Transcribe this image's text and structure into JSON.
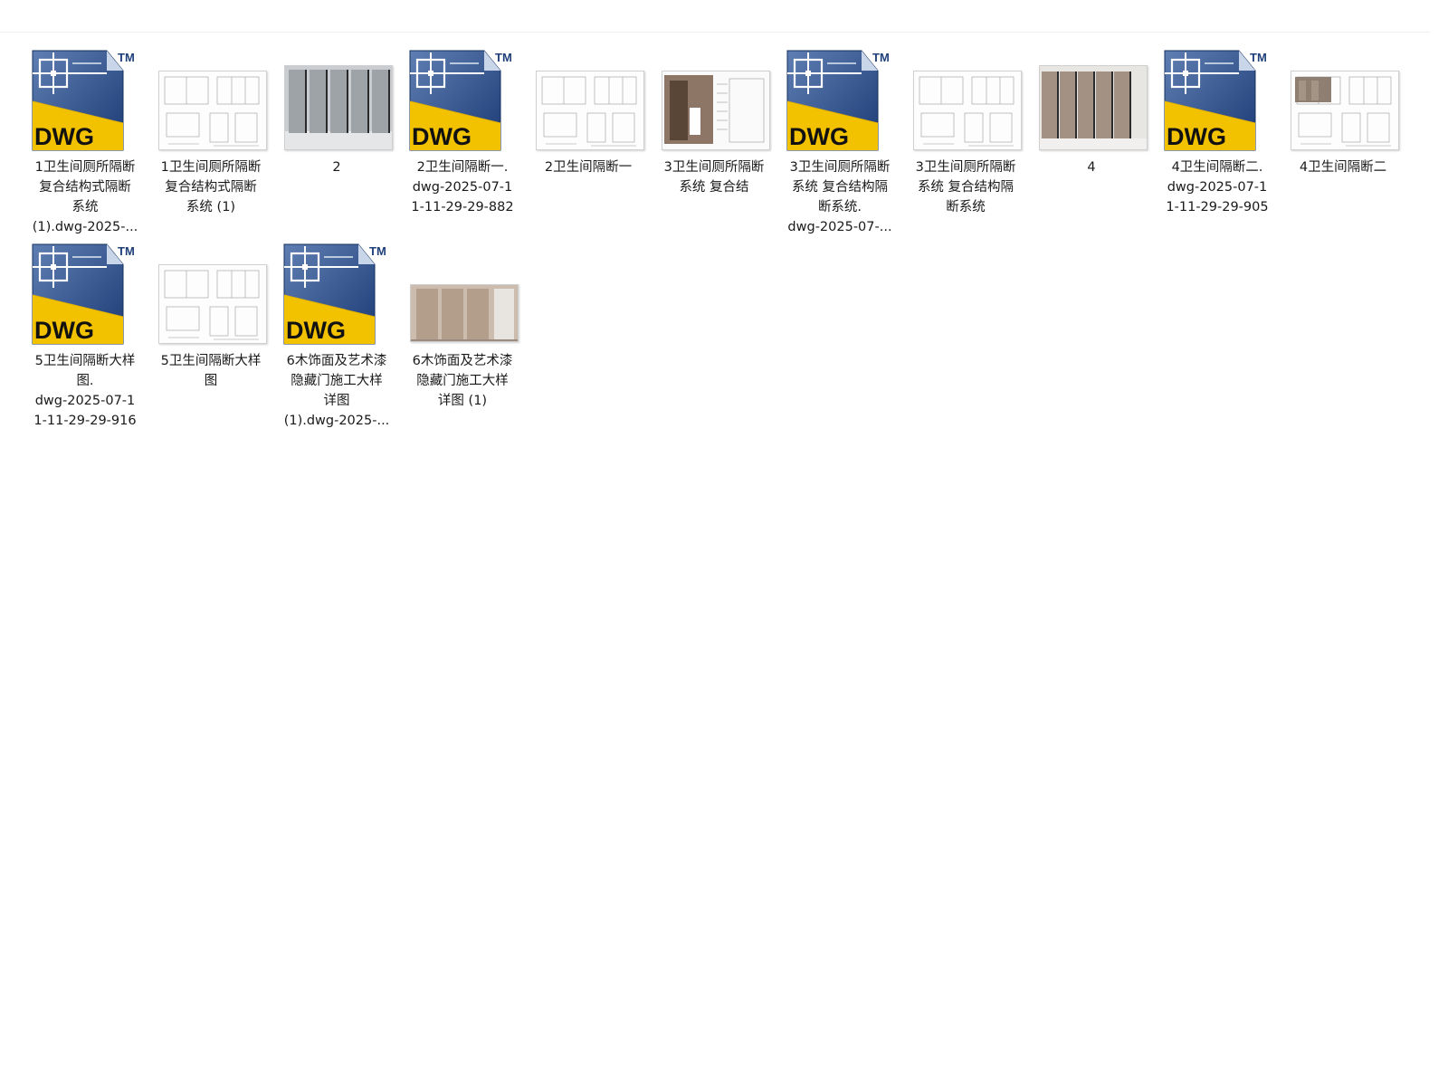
{
  "explorer": {
    "files": [
      {
        "kind": "dwg",
        "lines": [
          "1卫生间厕所隔断",
          "复合结构式隔断",
          "系统",
          "(1).dwg-2025-..."
        ]
      },
      {
        "kind": "sheet",
        "lines": [
          "1卫生间厕所隔断",
          "复合结构式隔断",
          "系统 (1)"
        ]
      },
      {
        "kind": "photo-grey",
        "lines": [
          "2"
        ]
      },
      {
        "kind": "dwg",
        "lines": [
          "2卫生间隔断一.",
          "dwg-2025-07-1",
          "1-11-29-29-882"
        ]
      },
      {
        "kind": "sheet",
        "lines": [
          "2卫生间隔断一"
        ]
      },
      {
        "kind": "photo-brown-doc",
        "lines": [
          "3卫生间厕所隔断",
          "系统 复合结"
        ]
      },
      {
        "kind": "dwg",
        "lines": [
          "3卫生间厕所隔断",
          "系统 复合结构隔",
          "断系统.",
          "dwg-2025-07-..."
        ]
      },
      {
        "kind": "sheet",
        "lines": [
          "3卫生间厕所隔断",
          "系统 复合结构隔",
          "断系统"
        ]
      },
      {
        "kind": "photo-taupe",
        "lines": [
          "4"
        ]
      },
      {
        "kind": "dwg",
        "lines": [
          "4卫生间隔断二.",
          "dwg-2025-07-1",
          "1-11-29-29-905"
        ]
      },
      {
        "kind": "sheet-photo",
        "lines": [
          "4卫生间隔断二"
        ]
      },
      {
        "kind": "dwg",
        "lines": [
          "5卫生间隔断大样",
          "图.",
          "dwg-2025-07-1",
          "1-11-29-29-916"
        ]
      },
      {
        "kind": "sheet",
        "lines": [
          "5卫生间隔断大样",
          "图"
        ]
      },
      {
        "kind": "dwg",
        "lines": [
          "6木饰面及艺术漆",
          "隐藏门施工大样",
          "详图",
          "(1).dwg-2025-..."
        ]
      },
      {
        "kind": "photo-wood",
        "lines": [
          "6木饰面及艺术漆",
          "隐藏门施工大样",
          "详图 (1)"
        ]
      }
    ],
    "dwg_icon": {
      "text": "DWG",
      "tm": "TM",
      "blue": "#1f3f7a",
      "yellow": "#f2c200"
    }
  }
}
